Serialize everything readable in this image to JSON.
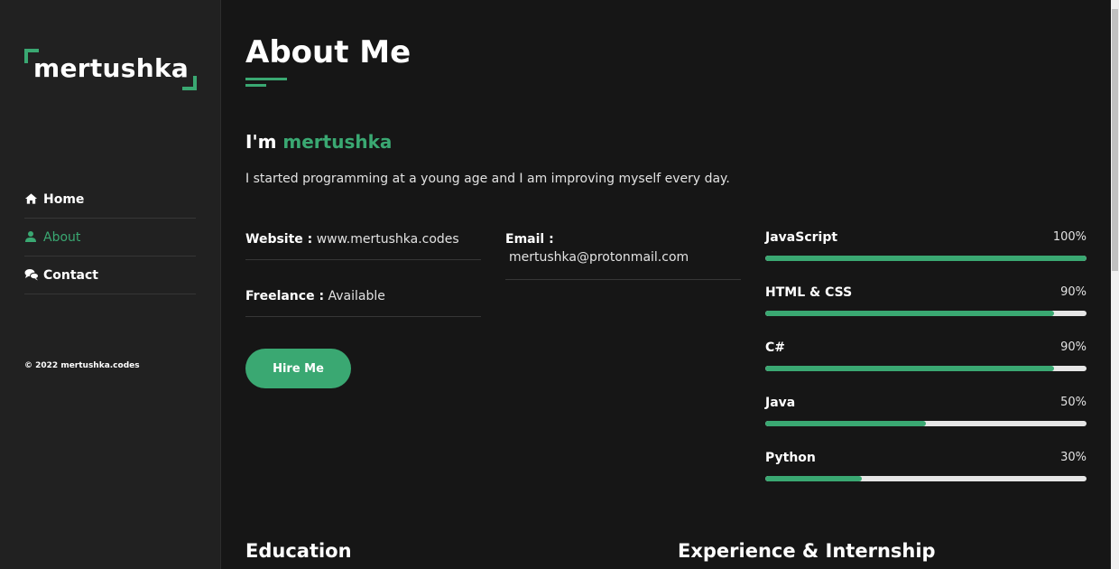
{
  "sidebar": {
    "logo": "mertushka",
    "nav": [
      {
        "label": "Home",
        "icon": "home-icon"
      },
      {
        "label": "About",
        "icon": "user-icon",
        "active": true
      },
      {
        "label": "Contact",
        "icon": "chat-icon"
      }
    ],
    "copyright": "© 2022 mertushka.codes"
  },
  "main": {
    "title": "About Me",
    "intro_prefix": "I'm",
    "intro_name": "mertushka",
    "intro_text": "I started programming at a young age and I am improving myself every day.",
    "info": {
      "website": {
        "label": "Website :",
        "value": "www.mertushka.codes"
      },
      "email": {
        "label": "Email :",
        "value": "mertushka@protonmail.com"
      },
      "freelance": {
        "label": "Freelance :",
        "value": "Available"
      }
    },
    "hire_button": "Hire Me",
    "skills": [
      {
        "name": "JavaScript",
        "percent_label": "100%",
        "value": 100
      },
      {
        "name": "HTML & CSS",
        "percent_label": "90%",
        "value": 90
      },
      {
        "name": "C#",
        "percent_label": "90%",
        "value": 90
      },
      {
        "name": "Java",
        "percent_label": "50%",
        "value": 50
      },
      {
        "name": "Python",
        "percent_label": "30%",
        "value": 30
      }
    ],
    "sections": {
      "education": "Education",
      "experience": "Experience & Internship"
    }
  },
  "colors": {
    "accent": "#3aa872",
    "background": "#161616",
    "sidebar": "#212121"
  }
}
